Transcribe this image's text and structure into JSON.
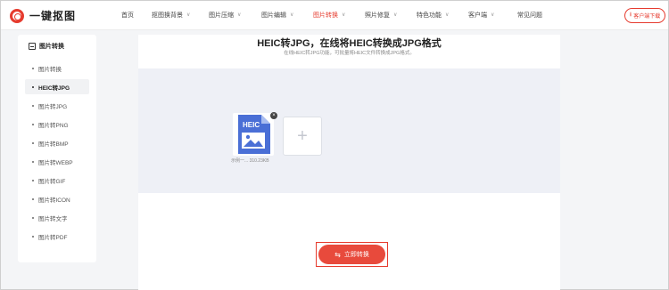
{
  "header": {
    "logo_text": "一键抠图",
    "nav": [
      {
        "label": "首页",
        "has_menu": false,
        "active": false
      },
      {
        "label": "抠图换背景",
        "has_menu": true,
        "active": false
      },
      {
        "label": "图片压缩",
        "has_menu": true,
        "active": false
      },
      {
        "label": "图片编辑",
        "has_menu": true,
        "active": false
      },
      {
        "label": "图片转换",
        "has_menu": true,
        "active": true
      },
      {
        "label": "照片修复",
        "has_menu": true,
        "active": false
      },
      {
        "label": "特色功能",
        "has_menu": true,
        "active": false
      },
      {
        "label": "客户端",
        "has_menu": true,
        "active": false
      },
      {
        "label": "常见问题",
        "has_menu": false,
        "active": false
      }
    ],
    "download_label": "客户端下载"
  },
  "sidebar": {
    "title": "图片转换",
    "items": [
      {
        "label": "图片转换",
        "active": false
      },
      {
        "label": "HEIC转JPG",
        "active": true
      },
      {
        "label": "图片转JPG",
        "active": false
      },
      {
        "label": "图片转PNG",
        "active": false
      },
      {
        "label": "图片转BMP",
        "active": false
      },
      {
        "label": "图片转WEBP",
        "active": false
      },
      {
        "label": "图片转GIF",
        "active": false
      },
      {
        "label": "图片转ICON",
        "active": false
      },
      {
        "label": "图片转文字",
        "active": false
      },
      {
        "label": "图片转PDF",
        "active": false
      }
    ]
  },
  "main": {
    "title": "HEIC转JPG，在线将HEIC转换成JPG格式",
    "subtitle": "在线HEIC转JPG功能，可批量将HEIC文件转换成JPG格式。",
    "file": {
      "badge": "HEIC",
      "name": "示例一...",
      "size": "310.23KB"
    },
    "convert_label": "立即转换"
  },
  "colors": {
    "accent": "#e63b2e",
    "drop_zone": "#eef0f6",
    "file_icon": "#4a6fd6"
  }
}
